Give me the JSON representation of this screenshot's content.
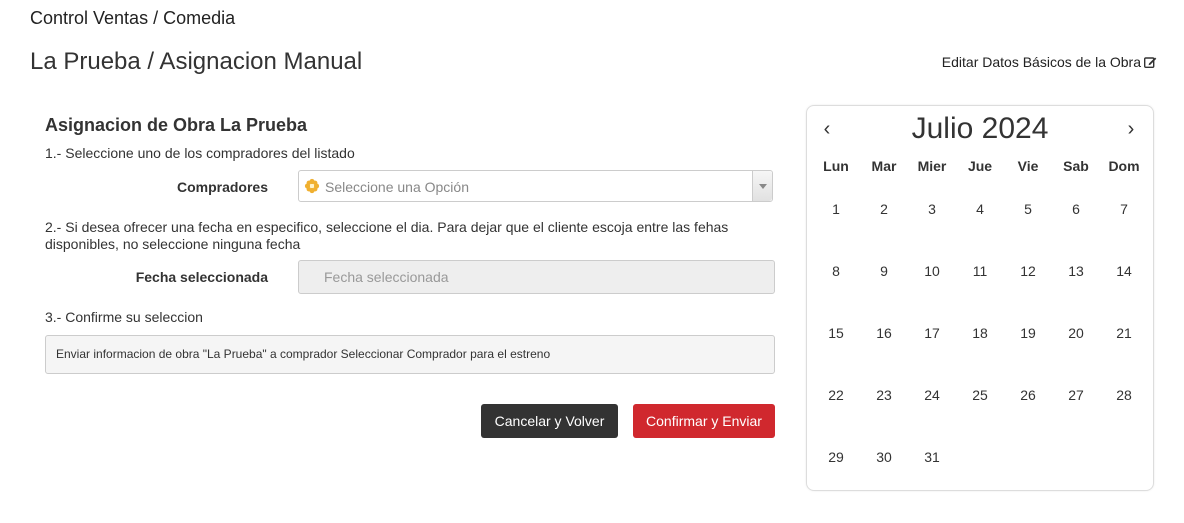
{
  "breadcrumb": "Control Ventas / Comedia",
  "page_title": "La Prueba / Asignacion Manual",
  "edit_link": "Editar Datos Básicos de la Obra",
  "form": {
    "section_title": "Asignacion de Obra La Prueba",
    "step1": "1.- Seleccione uno de los compradores del listado",
    "buyers_label": "Compradores",
    "buyers_placeholder": "Seleccione una Opción",
    "step2": "2.- Si desea ofrecer una fecha en especifico, seleccione el dia. Para dejar que el cliente escoja entre las fehas disponibles, no seleccione ninguna fecha",
    "date_label": "Fecha seleccionada",
    "date_placeholder": "Fecha seleccionada",
    "step3": "3.- Confirme su seleccion",
    "summary": "Enviar informacion de obra \"La Prueba\" a comprador Seleccionar Comprador para el estreno",
    "cancel_button": "Cancelar y Volver",
    "confirm_button": "Confirmar y Enviar"
  },
  "calendar": {
    "title": "Julio 2024",
    "prev": "‹",
    "next": "›",
    "weekdays": [
      "Lun",
      "Mar",
      "Mier",
      "Jue",
      "Vie",
      "Sab",
      "Dom"
    ],
    "weeks": [
      [
        "1",
        "2",
        "3",
        "4",
        "5",
        "6",
        "7"
      ],
      [
        "8",
        "9",
        "10",
        "11",
        "12",
        "13",
        "14"
      ],
      [
        "15",
        "16",
        "17",
        "18",
        "19",
        "20",
        "21"
      ],
      [
        "22",
        "23",
        "24",
        "25",
        "26",
        "27",
        "28"
      ],
      [
        "29",
        "30",
        "31",
        "",
        "",
        "",
        ""
      ]
    ]
  },
  "colors": {
    "confirm": "#d0282e",
    "cancel": "#333333",
    "flower_icon": "#f0b030"
  }
}
